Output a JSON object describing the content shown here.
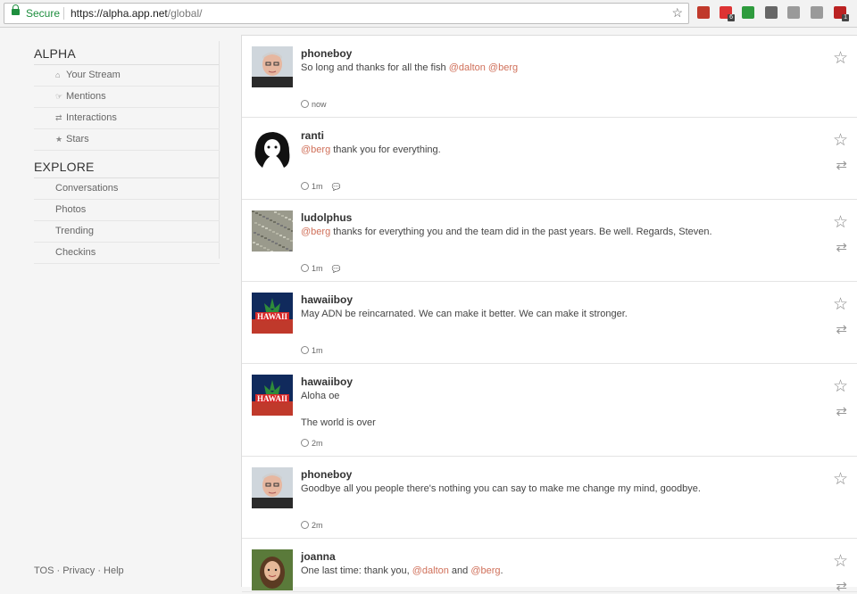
{
  "browser": {
    "secure_label": "Secure",
    "url_host": "https://alpha.app.net",
    "url_path": "/global/",
    "bookmark_icon": "star-outline-icon",
    "extensions": [
      {
        "icon": "extension-flag-icon",
        "color": "#c0392b",
        "badge": ""
      },
      {
        "icon": "extension-box-icon",
        "color": "#d33",
        "badge": "6"
      },
      {
        "icon": "extension-circle-icon",
        "color": "#2e9b3d",
        "badge": ""
      },
      {
        "icon": "extension-square-icon",
        "color": "#666",
        "badge": ""
      },
      {
        "icon": "extension-pin-icon",
        "color": "#9a9a9a",
        "badge": ""
      },
      {
        "icon": "extension-scissors-icon",
        "color": "#9a9a9a",
        "badge": ""
      },
      {
        "icon": "extension-shield-icon",
        "color": "#b22",
        "badge": "1"
      }
    ]
  },
  "sidebar": {
    "alpha_title": "ALPHA",
    "alpha_items": [
      {
        "icon": "home-icon",
        "glyph": "⌂",
        "label": "Your Stream"
      },
      {
        "icon": "mentions-icon",
        "glyph": "☞",
        "label": "Mentions"
      },
      {
        "icon": "interactions-icon",
        "glyph": "⇄",
        "label": "Interactions"
      },
      {
        "icon": "star-icon",
        "glyph": "★",
        "label": "Stars"
      }
    ],
    "explore_title": "EXPLORE",
    "explore_items": [
      {
        "label": "Conversations"
      },
      {
        "label": "Photos"
      },
      {
        "label": "Trending"
      },
      {
        "label": "Checkins"
      }
    ],
    "footer": {
      "tos": "TOS",
      "privacy": "Privacy",
      "help": "Help",
      "sep": " · "
    }
  },
  "posts": [
    {
      "username": "phoneboy",
      "avatar": "phoneboy",
      "lines": [
        [
          {
            "t": "So long and thanks for all the fish "
          },
          {
            "m": "@dalton"
          },
          {
            "t": " "
          },
          {
            "m": "@berg"
          }
        ]
      ],
      "time": "now",
      "replies": false,
      "repost": false
    },
    {
      "username": "ranti",
      "avatar": "ranti",
      "lines": [
        [
          {
            "m": "@berg"
          },
          {
            "t": " thank you for everything."
          }
        ]
      ],
      "time": "1m",
      "replies": true,
      "repost": true
    },
    {
      "username": "ludolphus",
      "avatar": "ludolphus",
      "lines": [
        [
          {
            "m": "@berg"
          },
          {
            "t": " thanks for everything you and the team did in the past years. Be well. Regards, Steven."
          }
        ]
      ],
      "time": "1m",
      "replies": true,
      "repost": true
    },
    {
      "username": "hawaiiboy",
      "avatar": "hawaii",
      "lines": [
        [
          {
            "t": "May ADN be reincarnated. We can make it better. We can make it stronger."
          }
        ]
      ],
      "time": "1m",
      "replies": false,
      "repost": true
    },
    {
      "username": "hawaiiboy",
      "avatar": "hawaii",
      "lines": [
        [
          {
            "t": "Aloha oe"
          }
        ],
        [
          {
            "t": ""
          }
        ],
        [
          {
            "t": "The world is over"
          }
        ]
      ],
      "time": "2m",
      "replies": false,
      "repost": true
    },
    {
      "username": "phoneboy",
      "avatar": "phoneboy",
      "lines": [
        [
          {
            "t": "Goodbye all you people there's nothing you can say to make me change my mind, goodbye."
          }
        ]
      ],
      "time": "2m",
      "replies": false,
      "repost": false
    },
    {
      "username": "joanna",
      "avatar": "joanna",
      "lines": [
        [
          {
            "t": "One last time: thank you, "
          },
          {
            "m": "@dalton"
          },
          {
            "t": " and "
          },
          {
            "m": "@berg"
          },
          {
            "t": "."
          }
        ]
      ],
      "time": "",
      "replies": false,
      "repost": true
    }
  ],
  "colors": {
    "mention": "#d0705a",
    "secure": "#1e8e3e"
  }
}
